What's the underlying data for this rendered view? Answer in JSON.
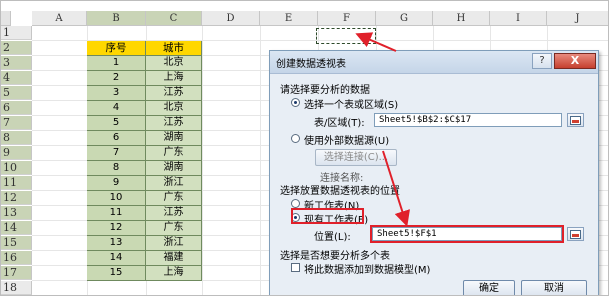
{
  "sheet": {
    "columns": [
      "A",
      "B",
      "C",
      "D",
      "E",
      "F",
      "G",
      "H",
      "I",
      "J"
    ],
    "rows": [
      "1",
      "2",
      "3",
      "4",
      "5",
      "6",
      "7",
      "8",
      "9",
      "10",
      "11",
      "12",
      "13",
      "14",
      "15",
      "16",
      "17",
      "18"
    ],
    "header": {
      "id": "序号",
      "city": "城市"
    },
    "data": [
      {
        "id": "1",
        "city": "北京"
      },
      {
        "id": "2",
        "city": "上海"
      },
      {
        "id": "3",
        "city": "江苏"
      },
      {
        "id": "4",
        "city": "北京"
      },
      {
        "id": "5",
        "city": "江苏"
      },
      {
        "id": "6",
        "city": "湖南"
      },
      {
        "id": "7",
        "city": "广东"
      },
      {
        "id": "8",
        "city": "湖南"
      },
      {
        "id": "9",
        "city": "浙江"
      },
      {
        "id": "10",
        "city": "广东"
      },
      {
        "id": "11",
        "city": "江苏"
      },
      {
        "id": "12",
        "city": "广东"
      },
      {
        "id": "13",
        "city": "浙江"
      },
      {
        "id": "14",
        "city": "福建"
      },
      {
        "id": "15",
        "city": "上海"
      }
    ]
  },
  "dialog": {
    "title": "创建数据透视表",
    "help_label": "?",
    "close_label": "X",
    "section1": "请选择要分析的数据",
    "opt_table": "选择一个表或区域(S)",
    "range_label": "表/区域(T):",
    "range_value": "Sheet5!$B$2:$C$17",
    "opt_external": "使用外部数据源(U)",
    "choose_conn": "选择连接(C)...",
    "conn_name": "连接名称:",
    "section2": "选择放置数据透视表的位置",
    "opt_new": "新工作表(N)",
    "opt_existing": "现有工作表(E)",
    "location_label": "位置(L):",
    "location_value": "Sheet5!$F$1",
    "section3": "选择是否想要分析多个表",
    "add_model": "将此数据添加到数据模型(M)",
    "ok": "确定",
    "cancel": "取消"
  },
  "colors": {
    "highlight": "#e0202a",
    "header_fill": "#ffd700",
    "data_fill": "#c9d9b3"
  }
}
